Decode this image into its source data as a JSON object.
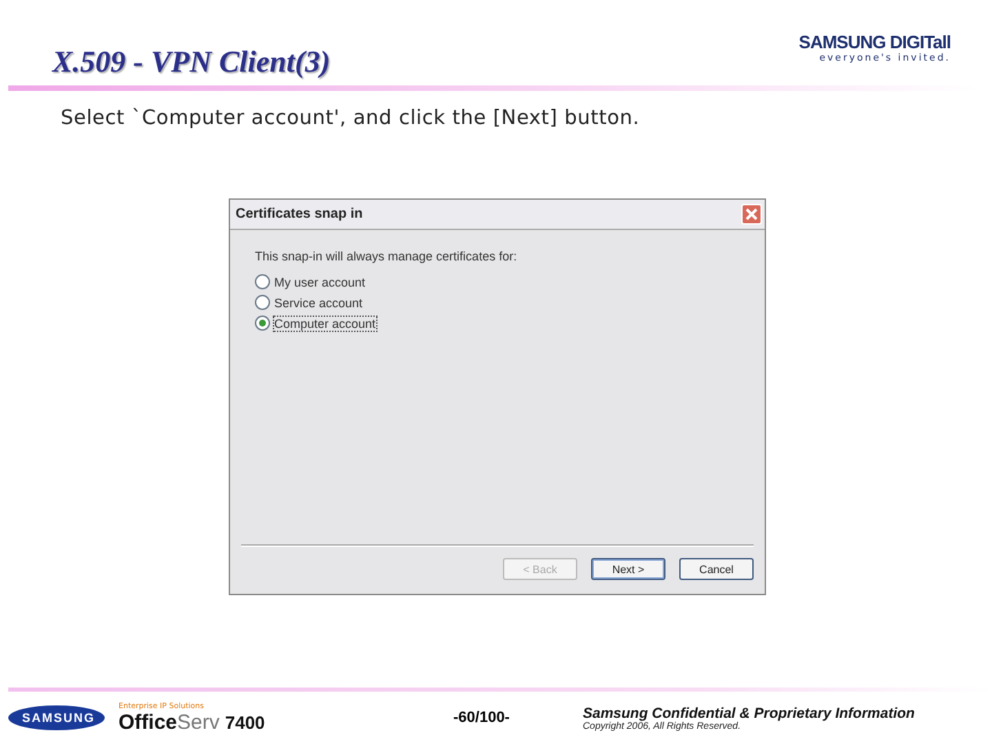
{
  "header": {
    "title": "X.509 - VPN Client(3)",
    "brand": "SAMSUNG DIGITall",
    "tagline": "everyone's invited."
  },
  "instruction": "Select `Computer account', and click the [Next] button.",
  "dialog": {
    "title": "Certificates snap in",
    "prompt": "This snap-in will always manage certificates for:",
    "options": [
      {
        "label": "My user account",
        "selected": false
      },
      {
        "label": "Service account",
        "selected": false
      },
      {
        "label": "Computer account",
        "selected": true
      }
    ],
    "buttons": [
      {
        "label": "< Back",
        "disabled": true
      },
      {
        "label": "Next >",
        "disabled": false
      },
      {
        "label": "Cancel",
        "disabled": false
      }
    ]
  },
  "footer": {
    "company_logo": "SAMSUNG",
    "product_tagline": "Enterprise IP Solutions",
    "product": "**Office**Serv",
    "model": "7400",
    "page": "-60/100-",
    "confidential": "Samsung Confidential & Proprietary Information",
    "copyright": "Copyright 2006, All Rights Reserved."
  }
}
